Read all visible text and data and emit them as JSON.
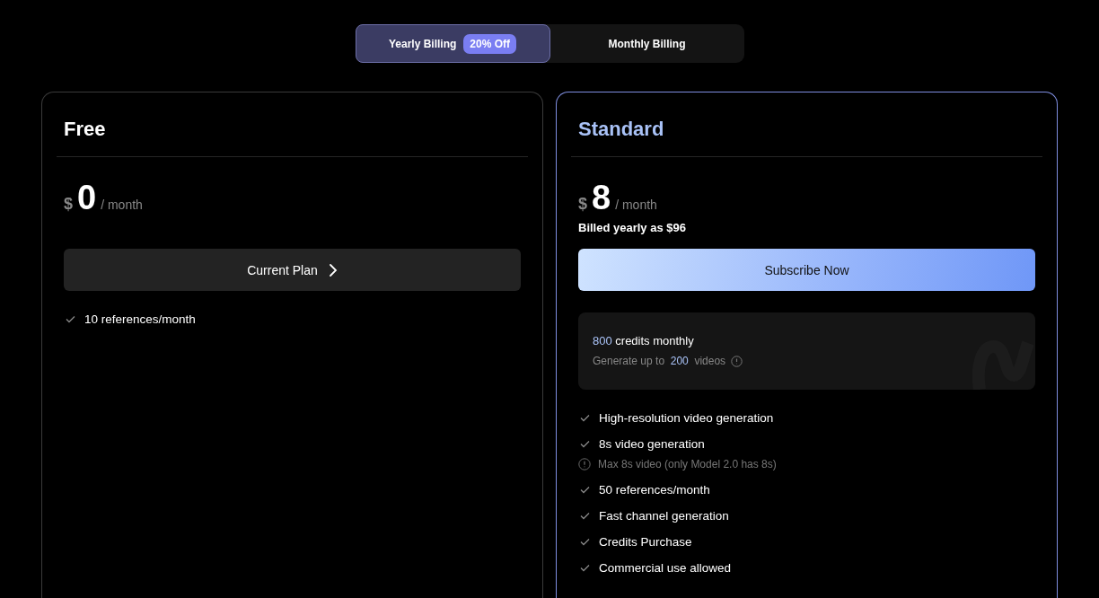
{
  "billing_toggle": [
    {
      "label": "Yearly Billing",
      "badge": "20% Off",
      "selected": true
    },
    {
      "label": "Monthly Billing",
      "selected": false
    }
  ],
  "plans": [
    {
      "name": "Free",
      "highlighted": false,
      "currency": "$",
      "amount": "0",
      "period": "/ month",
      "button": {
        "kind": "current",
        "label": "Current Plan"
      },
      "features": [
        {
          "text": "10 references/month"
        }
      ]
    },
    {
      "name": "Standard",
      "highlighted": true,
      "currency": "$",
      "amount": "8",
      "period": "/ month",
      "billed_note": "Billed yearly as $96",
      "button": {
        "kind": "subscribe",
        "label": "Subscribe Now"
      },
      "credits": {
        "amount": "800",
        "label": "credits monthly",
        "detail_prefix": "Generate up to",
        "detail_count": "200",
        "detail_suffix": "videos"
      },
      "features": [
        {
          "text": "High-resolution video generation"
        },
        {
          "text": "8s video generation",
          "note": "Max 8s video (only Model 2.0 has 8s)"
        },
        {
          "text": "50 references/month"
        },
        {
          "text": "Fast channel generation"
        },
        {
          "text": "Credits Purchase"
        },
        {
          "text": "Commercial use allowed"
        }
      ]
    }
  ]
}
